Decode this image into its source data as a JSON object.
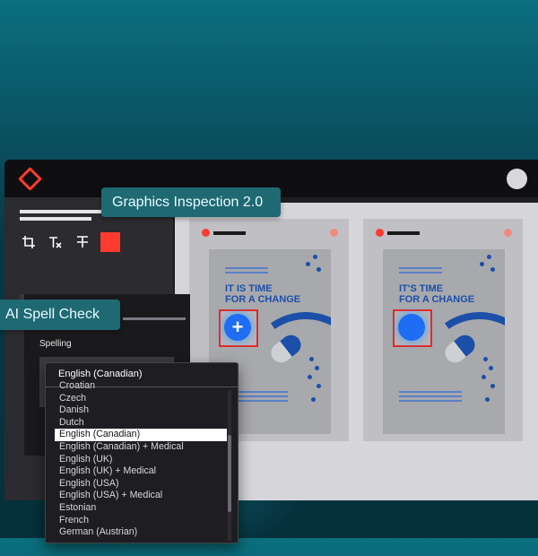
{
  "callouts": {
    "graphics_inspection": "Graphics Inspection 2.0",
    "ai_spell_check": "AI Spell Check"
  },
  "toolbar": {
    "icons": [
      "crop-icon",
      "text-format-icon",
      "strikethrough-text-icon",
      "color-swatch-icon"
    ],
    "swatch_color": "#ff3b30"
  },
  "posters": {
    "left_title": "IT IS TIME\nFOR A CHANGE",
    "right_title": "IT'S TIME\nFOR A CHANGE",
    "left_marker_symbol": "+"
  },
  "spell_panel": {
    "label": "Spelling"
  },
  "language_dropdown": {
    "selected": "English (Canadian)",
    "options": [
      "Croatian",
      "Czech",
      "Danish",
      "Dutch",
      "English (Canadian)",
      "English (Canadian) + Medical",
      "English (UK)",
      "English (UK) + Medical",
      "English (USA)",
      "English (USA) + Medical",
      "Estonian",
      "French",
      "German (Austrian)"
    ]
  },
  "colors": {
    "accent_red": "#ff3b30",
    "callout_teal": "#1f6973",
    "poster_blue": "#1c4fa8",
    "marker_blue": "#1f6df2"
  }
}
